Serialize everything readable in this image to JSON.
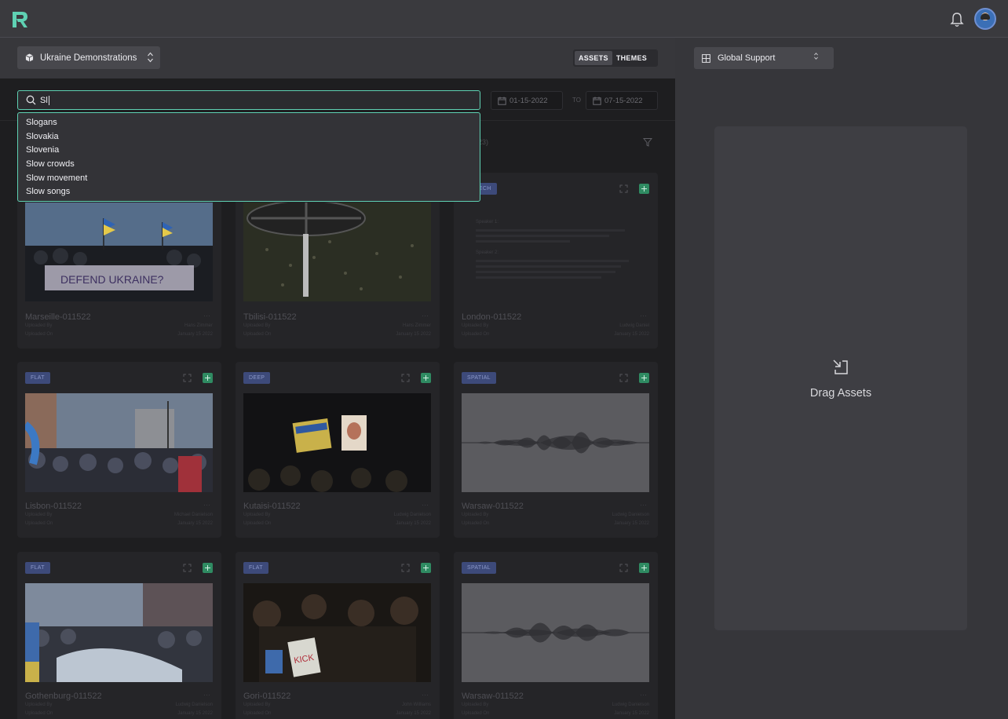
{
  "topbar": {
    "logo": "R",
    "notification_icon": "bell-icon"
  },
  "project": {
    "selected": "Ukraine Demonstrations",
    "icon": "cube-icon"
  },
  "view_toggle": {
    "assets": "ASSETS",
    "themes": "THEMES",
    "active": "ASSETS"
  },
  "search": {
    "value": "Sl"
  },
  "suggestions": [
    "Slogans",
    "Slovakia",
    "Slovenia",
    "Slow crowds",
    "Slow movement",
    "Slow songs"
  ],
  "date_range": {
    "from": "01-15-2022",
    "to_label": "TO",
    "to": "07-15-2022"
  },
  "filters": {
    "count_partial": "(23)"
  },
  "cards": [
    {
      "name": "Marseille-011522",
      "badge": "",
      "kind": "photo",
      "uploaded_by_label": "Uploaded By",
      "uploaded_by": "Hans Zimmer",
      "uploaded_on_label": "Uploaded On",
      "uploaded_on": "January 15 2022"
    },
    {
      "name": "Tbilisi-011522",
      "badge": "",
      "kind": "photo",
      "uploaded_by_label": "Uploaded By",
      "uploaded_by": "Hans Zimmer",
      "uploaded_on_label": "Uploaded On",
      "uploaded_on": "January 15 2022"
    },
    {
      "name": "London-011522",
      "badge": "SPEECH",
      "kind": "text",
      "uploaded_by_label": "Uploaded By",
      "uploaded_by": "Ludwig Daniel",
      "uploaded_on_label": "Uploaded On",
      "uploaded_on": "January 15 2022"
    },
    {
      "name": "Lisbon-011522",
      "badge": "FLAT",
      "kind": "photo",
      "uploaded_by_label": "Uploaded By",
      "uploaded_by": "Michael Danielson",
      "uploaded_on_label": "Uploaded On",
      "uploaded_on": "January 15 2022"
    },
    {
      "name": "Kutaisi-011522",
      "badge": "DEEP",
      "kind": "photo",
      "uploaded_by_label": "Uploaded By",
      "uploaded_by": "Ludwig Danielson",
      "uploaded_on_label": "Uploaded On",
      "uploaded_on": "January 15 2022"
    },
    {
      "name": "Warsaw-011522",
      "badge": "SPATIAL",
      "kind": "audio",
      "uploaded_by_label": "Uploaded By",
      "uploaded_by": "Ludwig Danielson",
      "uploaded_on_label": "Uploaded On",
      "uploaded_on": "January 15 2022"
    },
    {
      "name": "Gothenburg-011522",
      "badge": "FLAT",
      "kind": "photo",
      "uploaded_by_label": "Uploaded By",
      "uploaded_by": "Ludwig Danielson",
      "uploaded_on_label": "Uploaded On",
      "uploaded_on": "January 15 2022"
    },
    {
      "name": "Gori-011522",
      "badge": "FLAT",
      "kind": "photo",
      "uploaded_by_label": "Uploaded By",
      "uploaded_by": "John Williams",
      "uploaded_on_label": "Uploaded On",
      "uploaded_on": "January 15 2022"
    },
    {
      "name": "Warsaw-011522",
      "badge": "SPATIAL",
      "kind": "audio",
      "uploaded_by_label": "Uploaded By",
      "uploaded_by": "Ludwig Danielson",
      "uploaded_on_label": "Uploaded On",
      "uploaded_on": "January 15 2022"
    }
  ],
  "speech_preview": {
    "speaker1": "Speaker 1:",
    "speaker2": "Speaker 2:"
  },
  "theme_select": {
    "selected": "Global Support",
    "icon": "grid-icon"
  },
  "dropzone": {
    "label": "Drag Assets",
    "icon": "drop-in-icon"
  },
  "colors": {
    "accent": "#5fd1b3",
    "badge_bg": "#3d4a7a",
    "add": "#2f8b62"
  }
}
